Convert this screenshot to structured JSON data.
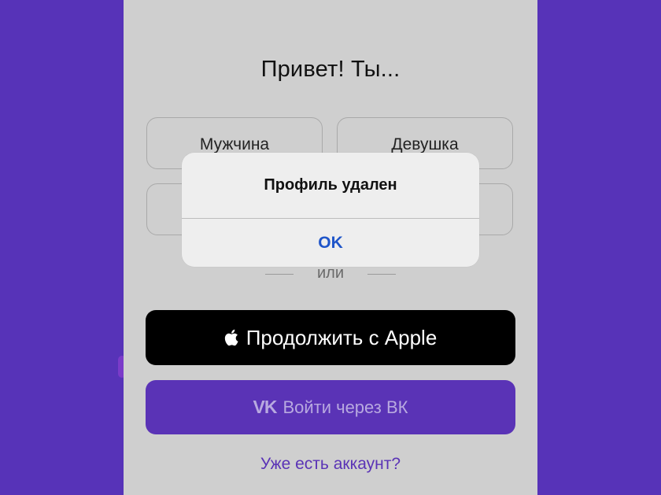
{
  "screen": {
    "greeting": "Привет! Ты...",
    "choices": [
      {
        "label": "Мужчина"
      },
      {
        "label": "Девушка"
      },
      {
        "label": ""
      },
      {
        "label": ""
      }
    ],
    "divider_text": "или",
    "apple_button": {
      "label": "Продолжить с Apple",
      "icon": "apple-icon"
    },
    "vk_button": {
      "label": "Войти через ВК",
      "icon": "vk-icon"
    },
    "existing_account_link": "Уже есть аккаунт?"
  },
  "alert": {
    "title": "Профиль удален",
    "ok_label": "OK"
  },
  "colors": {
    "background": "#5733b8",
    "screen": "#cfcfcf",
    "apple_button": "#000000",
    "vk_button": "#5a33b6",
    "alert_background": "#eeeeee",
    "alert_action": "#1f55c9"
  }
}
